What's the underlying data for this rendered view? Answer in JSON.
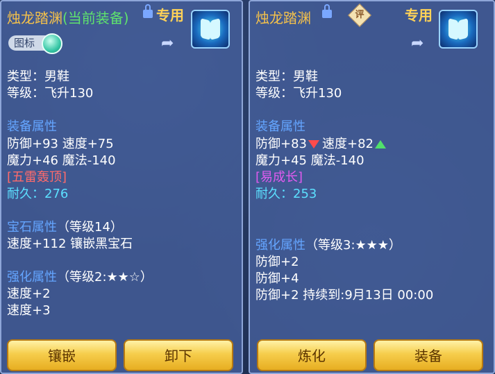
{
  "left": {
    "title": "烛龙踏渊",
    "equipped": "(当前装备)",
    "exclusive": "专用",
    "icon_toggle_label": "图标",
    "type_line": "类型：男鞋",
    "level_line": "等级：飞升130",
    "equip_attr_title": "装备属性",
    "attrs_line1": "防御+93 速度+75",
    "attrs_line2": "魔力+46 魔法-140",
    "special": "[五雷轰顶]",
    "durability": "耐久：276",
    "gem_title": "宝石属性",
    "gem_grade": "（等级14）",
    "gem_line": "速度+112 镶嵌黑宝石",
    "enhance_title": "强化属性",
    "enhance_grade": "（等级2:★★☆）",
    "enhance_line1": "速度+2",
    "enhance_line2": "速度+3",
    "buttons": [
      "镶嵌",
      "卸下"
    ]
  },
  "right": {
    "title": "烛龙踏渊",
    "rating_badge": "评",
    "exclusive": "专用",
    "type_line": "类型：男鞋",
    "level_line": "等级：飞升130",
    "equip_attr_title": "装备属性",
    "attrs_line1_a": "防御+83",
    "attrs_line1_b": "速度+82",
    "attrs_line2": "魔力+45 魔法-140",
    "special": "[易成长]",
    "durability": "耐久：253",
    "enhance_title": "强化属性",
    "enhance_grade": "（等级3:★★★）",
    "enhance_line1": "防御+2",
    "enhance_line2": "防御+4",
    "enhance_line3": "防御+2  持续到:9月13日 00:00",
    "buttons": [
      "炼化",
      "装备"
    ]
  }
}
